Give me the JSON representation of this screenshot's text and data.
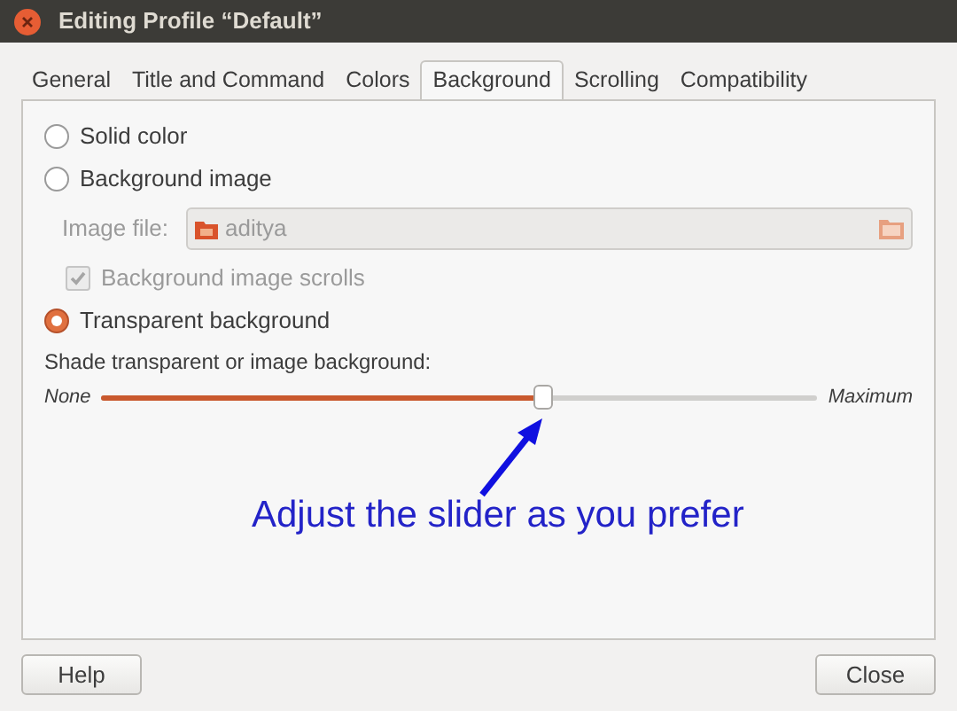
{
  "window": {
    "title": "Editing Profile “Default”"
  },
  "tabs": [
    {
      "label": "General",
      "selected": false
    },
    {
      "label": "Title and Command",
      "selected": false
    },
    {
      "label": "Colors",
      "selected": false
    },
    {
      "label": "Background",
      "selected": true
    },
    {
      "label": "Scrolling",
      "selected": false
    },
    {
      "label": "Compatibility",
      "selected": false
    }
  ],
  "background_options": [
    {
      "label": "Solid color",
      "selected": false
    },
    {
      "label": "Background image",
      "selected": false
    },
    {
      "label": "Transparent background",
      "selected": true
    }
  ],
  "image_file": {
    "label": "Image file:",
    "value": "aditya",
    "disabled": true
  },
  "scroll_option": {
    "label": "Background image scrolls",
    "checked": true,
    "disabled": true
  },
  "shade": {
    "label": "Shade transparent or image background:",
    "min_label": "None",
    "max_label": "Maximum",
    "level": 0.615
  },
  "annotation": {
    "text": "Adjust the slider as you prefer"
  },
  "buttons": [
    {
      "label": "Help"
    },
    {
      "label": "Close"
    }
  ]
}
